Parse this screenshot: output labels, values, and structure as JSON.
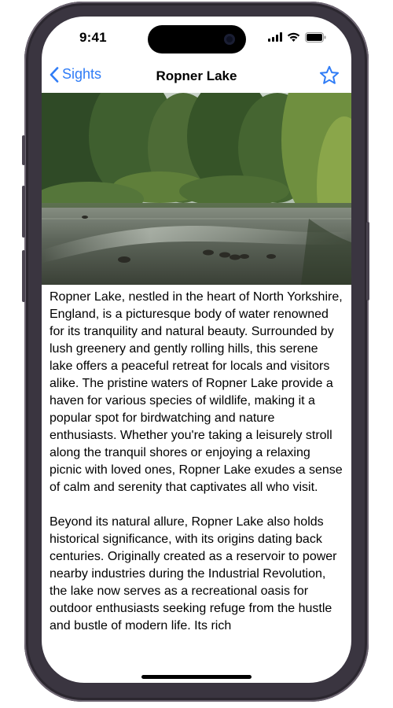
{
  "status_bar": {
    "time": "9:41",
    "icons": [
      "signal-icon",
      "wifi-icon",
      "battery-icon"
    ]
  },
  "nav": {
    "back_label": "Sights",
    "title": "Ropner Lake",
    "favorite_icon": "star-outline-icon"
  },
  "colors": {
    "accent": "#2F7CF6",
    "background": "#FFFFFF",
    "text": "#000000"
  },
  "content": {
    "paragraphs": [
      "Ropner Lake, nestled in the heart of North Yorkshire, England, is a picturesque body of water renowned for its tranquility and natural beauty. Surrounded by lush greenery and gently rolling hills, this serene lake offers a peaceful retreat for locals and visitors alike. The pristine waters of Ropner Lake provide a haven for various species of wildlife, making it a popular spot for birdwatching and nature enthusiasts. Whether you're taking a leisurely stroll along the tranquil shores or enjoying a relaxing picnic with loved ones, Ropner Lake exudes a sense of calm and serenity that captivates all who visit.",
      "Beyond its natural allure, Ropner Lake also holds historical significance, with its origins dating back centuries. Originally created as a reservoir to power nearby industries during the Industrial Revolution, the lake now serves as a recreational oasis for outdoor enthusiasts seeking refuge from the hustle and bustle of modern life. Its rich"
    ]
  }
}
